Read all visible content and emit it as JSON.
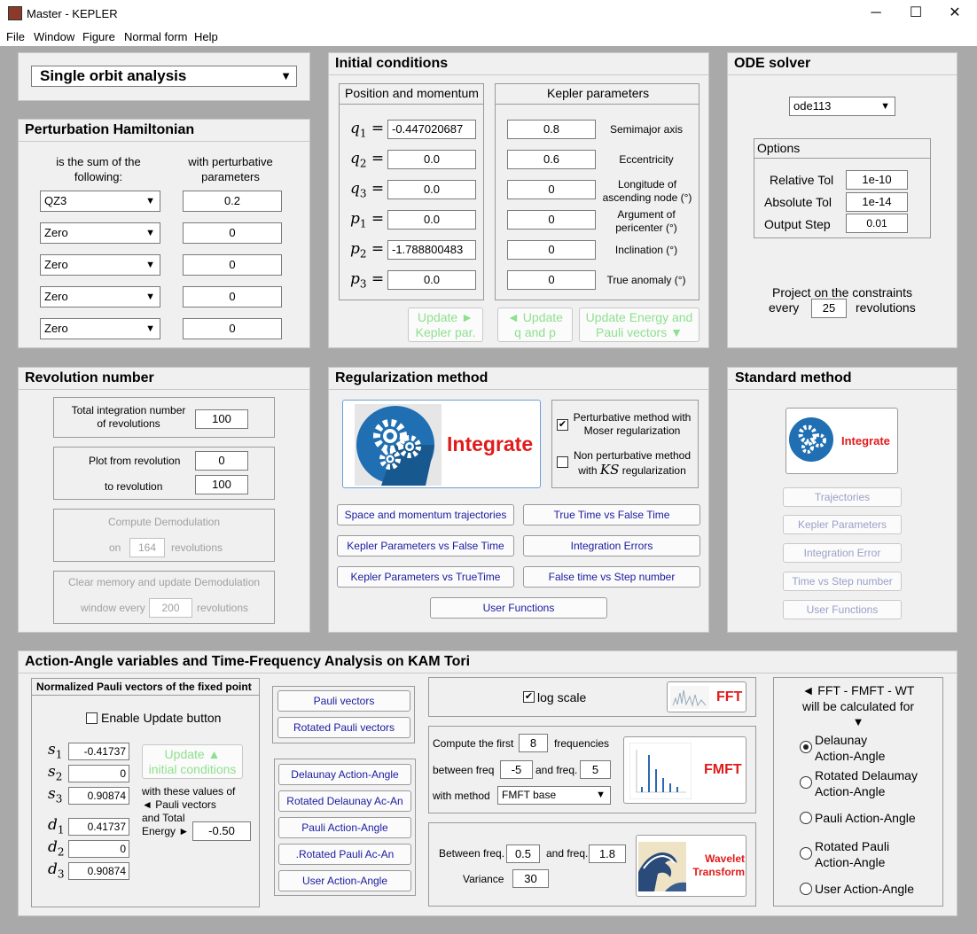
{
  "window": {
    "title": "Master - KEPLER",
    "minimize": "─",
    "maximize": "☐",
    "close": "✕"
  },
  "menu": [
    "File",
    "Window",
    "Figure",
    "Normal form",
    "Help"
  ],
  "analysis_select": {
    "value": "Single orbit analysis"
  },
  "perturbation": {
    "title": "Perturbation Hamiltonian",
    "col1": "is the sum of the following:",
    "col2": "with perturbative parameters",
    "rows": [
      {
        "term": "QZ3",
        "param": "0.2"
      },
      {
        "term": "Zero",
        "param": "0"
      },
      {
        "term": "Zero",
        "param": "0"
      },
      {
        "term": "Zero",
        "param": "0"
      },
      {
        "term": "Zero",
        "param": "0"
      }
    ]
  },
  "initial": {
    "title": "Initial conditions",
    "pos_title": "Position and momentum",
    "kep_title": "Kepler parameters",
    "pos": [
      {
        "sym": "q",
        "sub": "1",
        "value": "-0.447020687"
      },
      {
        "sym": "q",
        "sub": "2",
        "value": "0.0"
      },
      {
        "sym": "q",
        "sub": "3",
        "value": "0.0"
      },
      {
        "sym": "p",
        "sub": "1",
        "value": "0.0"
      },
      {
        "sym": "p",
        "sub": "2",
        "value": "-1.788800483"
      },
      {
        "sym": "p",
        "sub": "3",
        "value": "0.0"
      }
    ],
    "kep": [
      {
        "value": "0.8",
        "label": "Semimajor axis"
      },
      {
        "value": "0.6",
        "label": "Eccentricity"
      },
      {
        "value": "0",
        "label": "Longitude of ascending node (°)"
      },
      {
        "value": "0",
        "label": "Argument of pericenter (°)"
      },
      {
        "value": "0",
        "label": "Inclination (°)"
      },
      {
        "value": "0",
        "label": "True anomaly (°)"
      }
    ],
    "btn_update_kepler": [
      "Update ►",
      "Kepler par."
    ],
    "btn_update_qp": [
      "◄ Update",
      "q and p"
    ],
    "btn_update_energy": [
      "Update Energy and",
      "Pauli vectors ▼"
    ]
  },
  "ode": {
    "title": "ODE solver",
    "solver": "ode113",
    "options_title": "Options",
    "rel_label": "Relative Tol",
    "rel_value": "1e-10",
    "abs_label": "Absolute Tol",
    "abs_value": "1e-14",
    "step_label": "Output Step",
    "step_value": "0.01",
    "project_label": "Project on the constraints",
    "every_label": "every",
    "every_value": "25",
    "rev_label": "revolutions"
  },
  "revolution": {
    "title": "Revolution number",
    "total_label": "Total integration number of revolutions",
    "total_value": "100",
    "plot_from_label": "Plot from revolution",
    "plot_from_value": "0",
    "to_label": "to revolution",
    "to_value": "100",
    "demod_label": "Compute Demodulation",
    "on_label": "on",
    "on_value": "164",
    "on_rev": "revolutions",
    "clear_label": "Clear memory and update Demodulation",
    "window_label": "window every",
    "window_value": "200",
    "window_rev": "revolutions"
  },
  "regularization": {
    "title": "Regularization method",
    "integrate": "Integrate",
    "opt1": "Perturbative method with Moser regularization",
    "opt2_a": "Non perturbative method",
    "opt2_b": "with",
    "opt2_ks": "KS",
    "opt2_c": "regularization",
    "buttons": [
      "Space and momentum trajectories",
      "True Time vs False Time",
      "Kepler Parameters vs False Time",
      "Integration Errors",
      "Kepler Parameters vs TrueTime",
      "False time vs Step number"
    ],
    "user_functions": "User Functions"
  },
  "standard": {
    "title": "Standard method",
    "integrate": "Integrate",
    "buttons": [
      "Trajectories",
      "Kepler Parameters",
      "Integration Error",
      "Time vs Step number",
      "User Functions"
    ]
  },
  "action": {
    "title": "Action-Angle variables and Time-Frequency Analysis on KAM Tori",
    "pauli_title": "Normalized  Pauli vectors of the fixed point",
    "enable_label": "Enable Update button",
    "vars": [
      {
        "sym": "s",
        "sub": "1",
        "value": "-0.41737"
      },
      {
        "sym": "s",
        "sub": "2",
        "value": "0"
      },
      {
        "sym": "s",
        "sub": "3",
        "value": "0.90874"
      },
      {
        "sym": "d",
        "sub": "1",
        "value": "0.41737"
      },
      {
        "sym": "d",
        "sub": "2",
        "value": "0"
      },
      {
        "sym": "d",
        "sub": "3",
        "value": "0.90874"
      }
    ],
    "update_btn": [
      "Update    ▲",
      "initial conditions"
    ],
    "with_these": "with these values of",
    "pauli_vec": "◄ Pauli vectors",
    "and_total": "and Total",
    "energy": "Energy ►",
    "energy_value": "-0.50",
    "pauli_buttons": [
      "Pauli vectors",
      "Rotated Pauli vectors"
    ],
    "aa_buttons": [
      "Delaunay Action-Angle",
      "Rotated Delaunay Ac-An",
      "Pauli Action-Angle",
      ".Rotated Pauli Ac-An",
      "User Action-Angle"
    ],
    "log_scale": "log scale",
    "fft": "FFT",
    "compute_first": "Compute the first",
    "freq_count": "8",
    "frequencies": "frequencies",
    "between_freq": "between freq",
    "freq_lo": "-5",
    "and_freq": "and freq.",
    "freq_hi": "5",
    "with_method": "with method",
    "method": "FMFT base",
    "fmft": "FMFT",
    "wave_between": "Between freq.",
    "wave_lo": "0.5",
    "wave_and": "and freq.",
    "wave_hi": "1.8",
    "variance_label": "Variance",
    "variance_value": "30",
    "wavelet": "Wavelet Transform",
    "calc_for_1": "◄  FFT - FMFT - WT",
    "calc_for_2": "will be calculated for",
    "calc_for_3": "▼",
    "radio": [
      "Delaunay Action-Angle",
      "Rotated Delaumay Action-Angle",
      "Pauli Action-Angle",
      "Rotated Pauli Action-Angle",
      "User Action-Angle"
    ],
    "radio_selected": 0
  },
  "colors": {
    "accent_red": "#e01b1b",
    "link_blue": "#1a1aa0",
    "disabled_green": "#8ee08e",
    "gear_blue": "#1f6fb2"
  }
}
